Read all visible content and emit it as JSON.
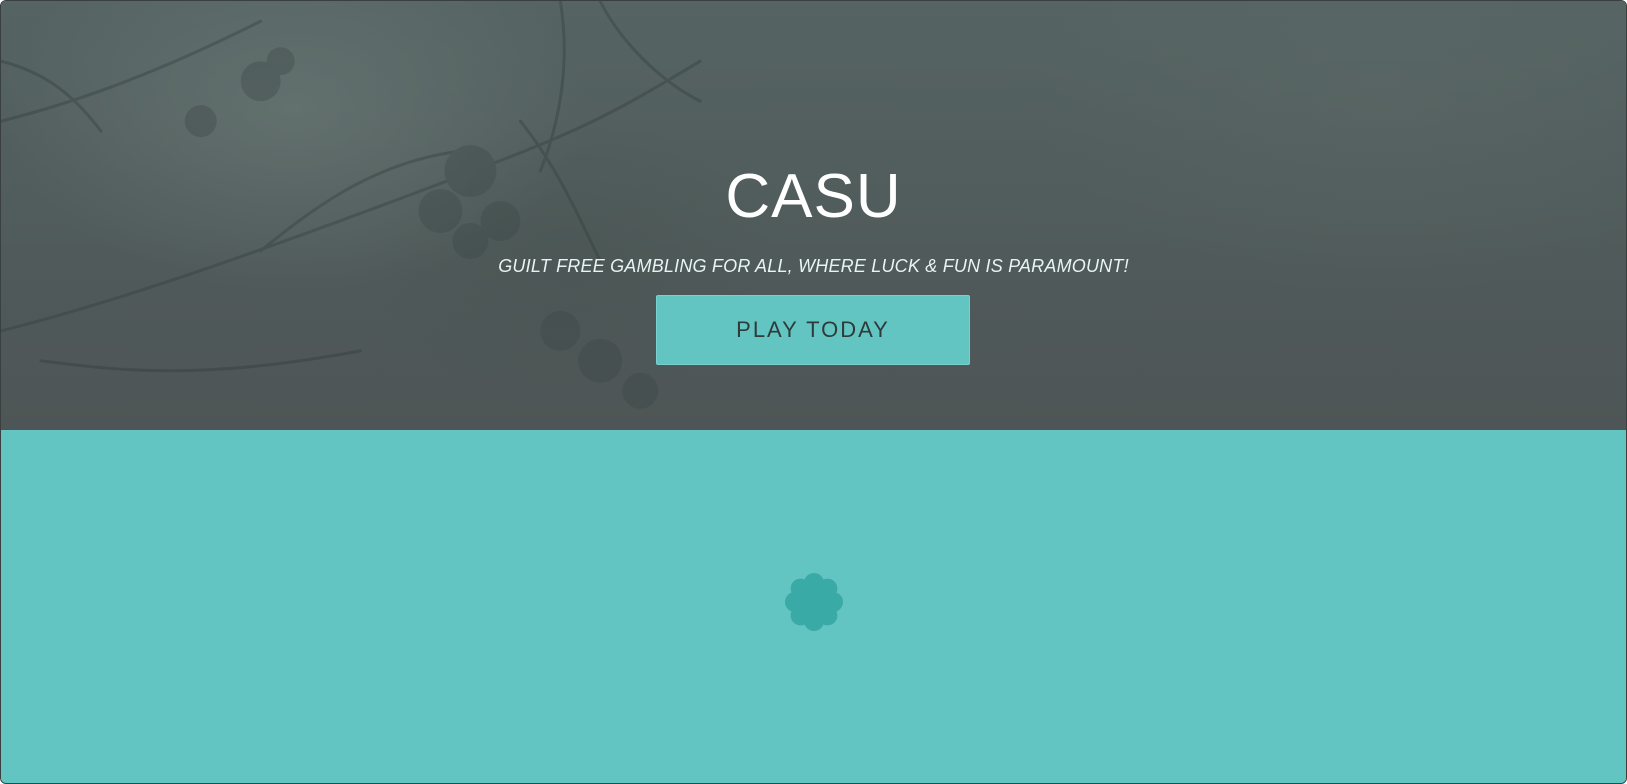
{
  "hero": {
    "title": "CASU",
    "tagline": "GUILT FREE GAMBLING FOR ALL, WHERE LUCK & FUN IS PARAMOUNT!",
    "cta_label": "PLAY TODAY"
  },
  "loader": {
    "icon": "spinner-flower-icon"
  },
  "colors": {
    "accent": "#63c5c2",
    "loader": "#3aaaa6",
    "hero_overlay": "#505a5a",
    "button_text": "#2f3b3b"
  }
}
